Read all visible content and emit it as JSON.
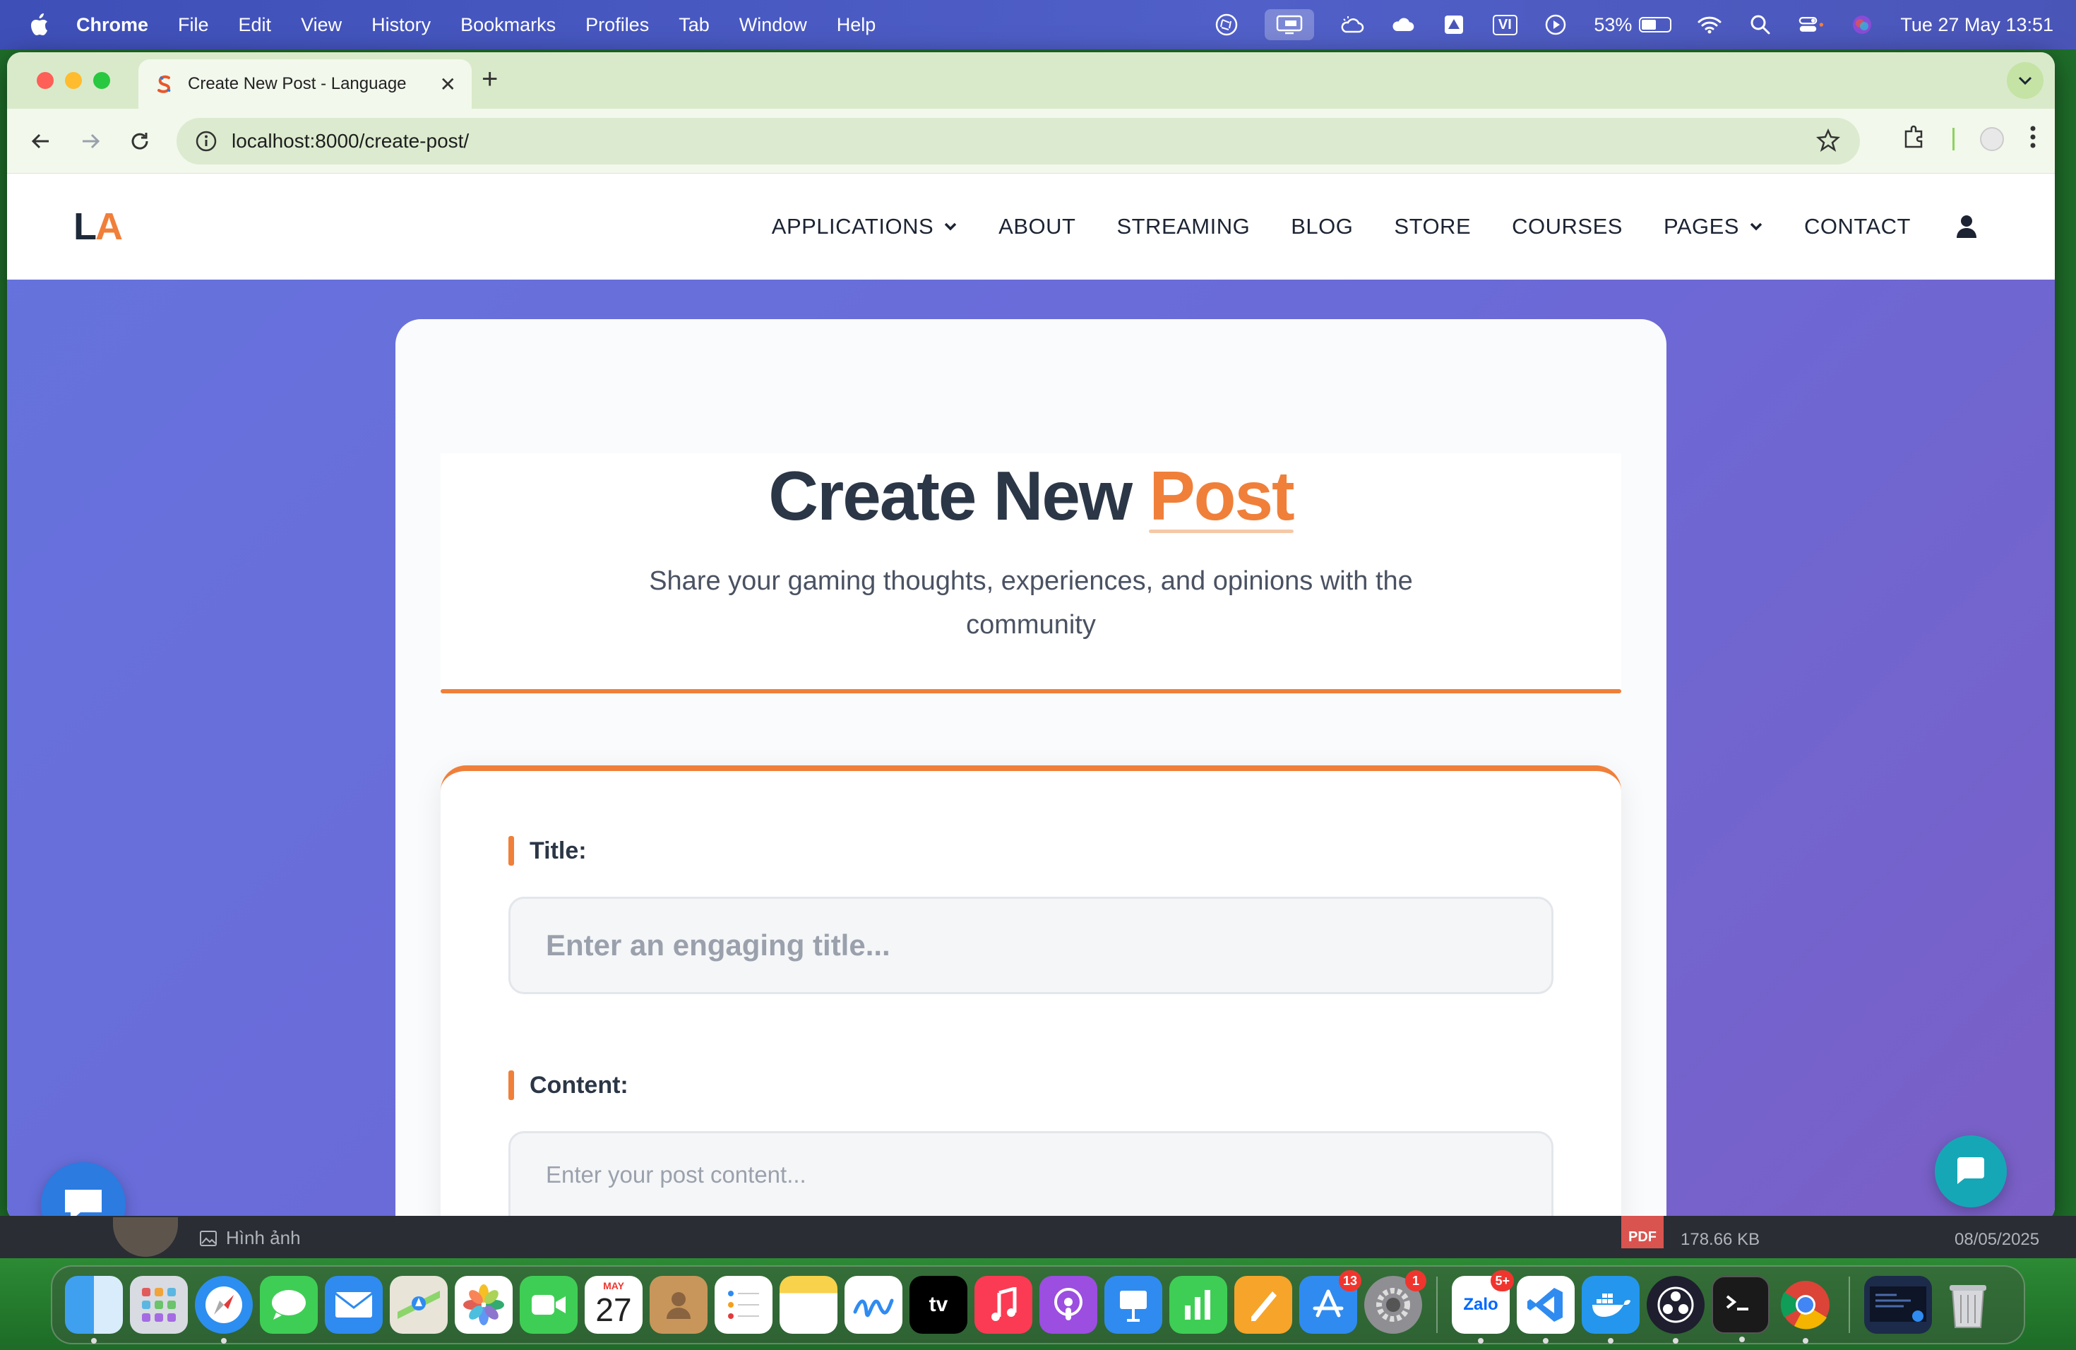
{
  "menubar": {
    "app": "Chrome",
    "items": [
      "File",
      "Edit",
      "View",
      "History",
      "Bookmarks",
      "Profiles",
      "Tab",
      "Window",
      "Help"
    ],
    "battery_percent": "53%",
    "battery_level": 0.53,
    "input_source": "VI",
    "datetime": "Tue 27 May  13:51"
  },
  "browser": {
    "tab_title": "Create New Post - Language",
    "url_host": "localhost",
    "url_path": ":8000/create-post/"
  },
  "site": {
    "logo_l": "L",
    "logo_a": "A",
    "nav": [
      {
        "label": "APPLICATIONS",
        "dropdown": true
      },
      {
        "label": "ABOUT"
      },
      {
        "label": "STREAMING"
      },
      {
        "label": "BLOG"
      },
      {
        "label": "STORE"
      },
      {
        "label": "COURSES"
      },
      {
        "label": "PAGES",
        "dropdown": true
      },
      {
        "label": "CONTACT"
      }
    ]
  },
  "hero": {
    "title_main": "Create New ",
    "title_accent": "Post",
    "subtitle": "Share your gaming thoughts, experiences, and opinions with the community"
  },
  "form": {
    "title_label": "Title:",
    "title_placeholder": "Enter an engaging title...",
    "content_label": "Content:",
    "content_placeholder": "Enter your post content..."
  },
  "background_app": {
    "image_label": "Hình ảnh",
    "file_icon": "PDF",
    "file_size": "178.66 KB",
    "date": "08/05/2025"
  },
  "dock": {
    "calendar_month": "MAY",
    "calendar_day": "27",
    "appstore_badge": "13",
    "settings_badge": "1",
    "zalo_badge": "5+",
    "zalo_label": "Zalo",
    "tv_label": "tv"
  },
  "colors": {
    "accent": "#f07f3a",
    "heading": "#2b3646",
    "page_gradient_start": "#6673dd",
    "page_gradient_end": "#7a5fc6"
  }
}
